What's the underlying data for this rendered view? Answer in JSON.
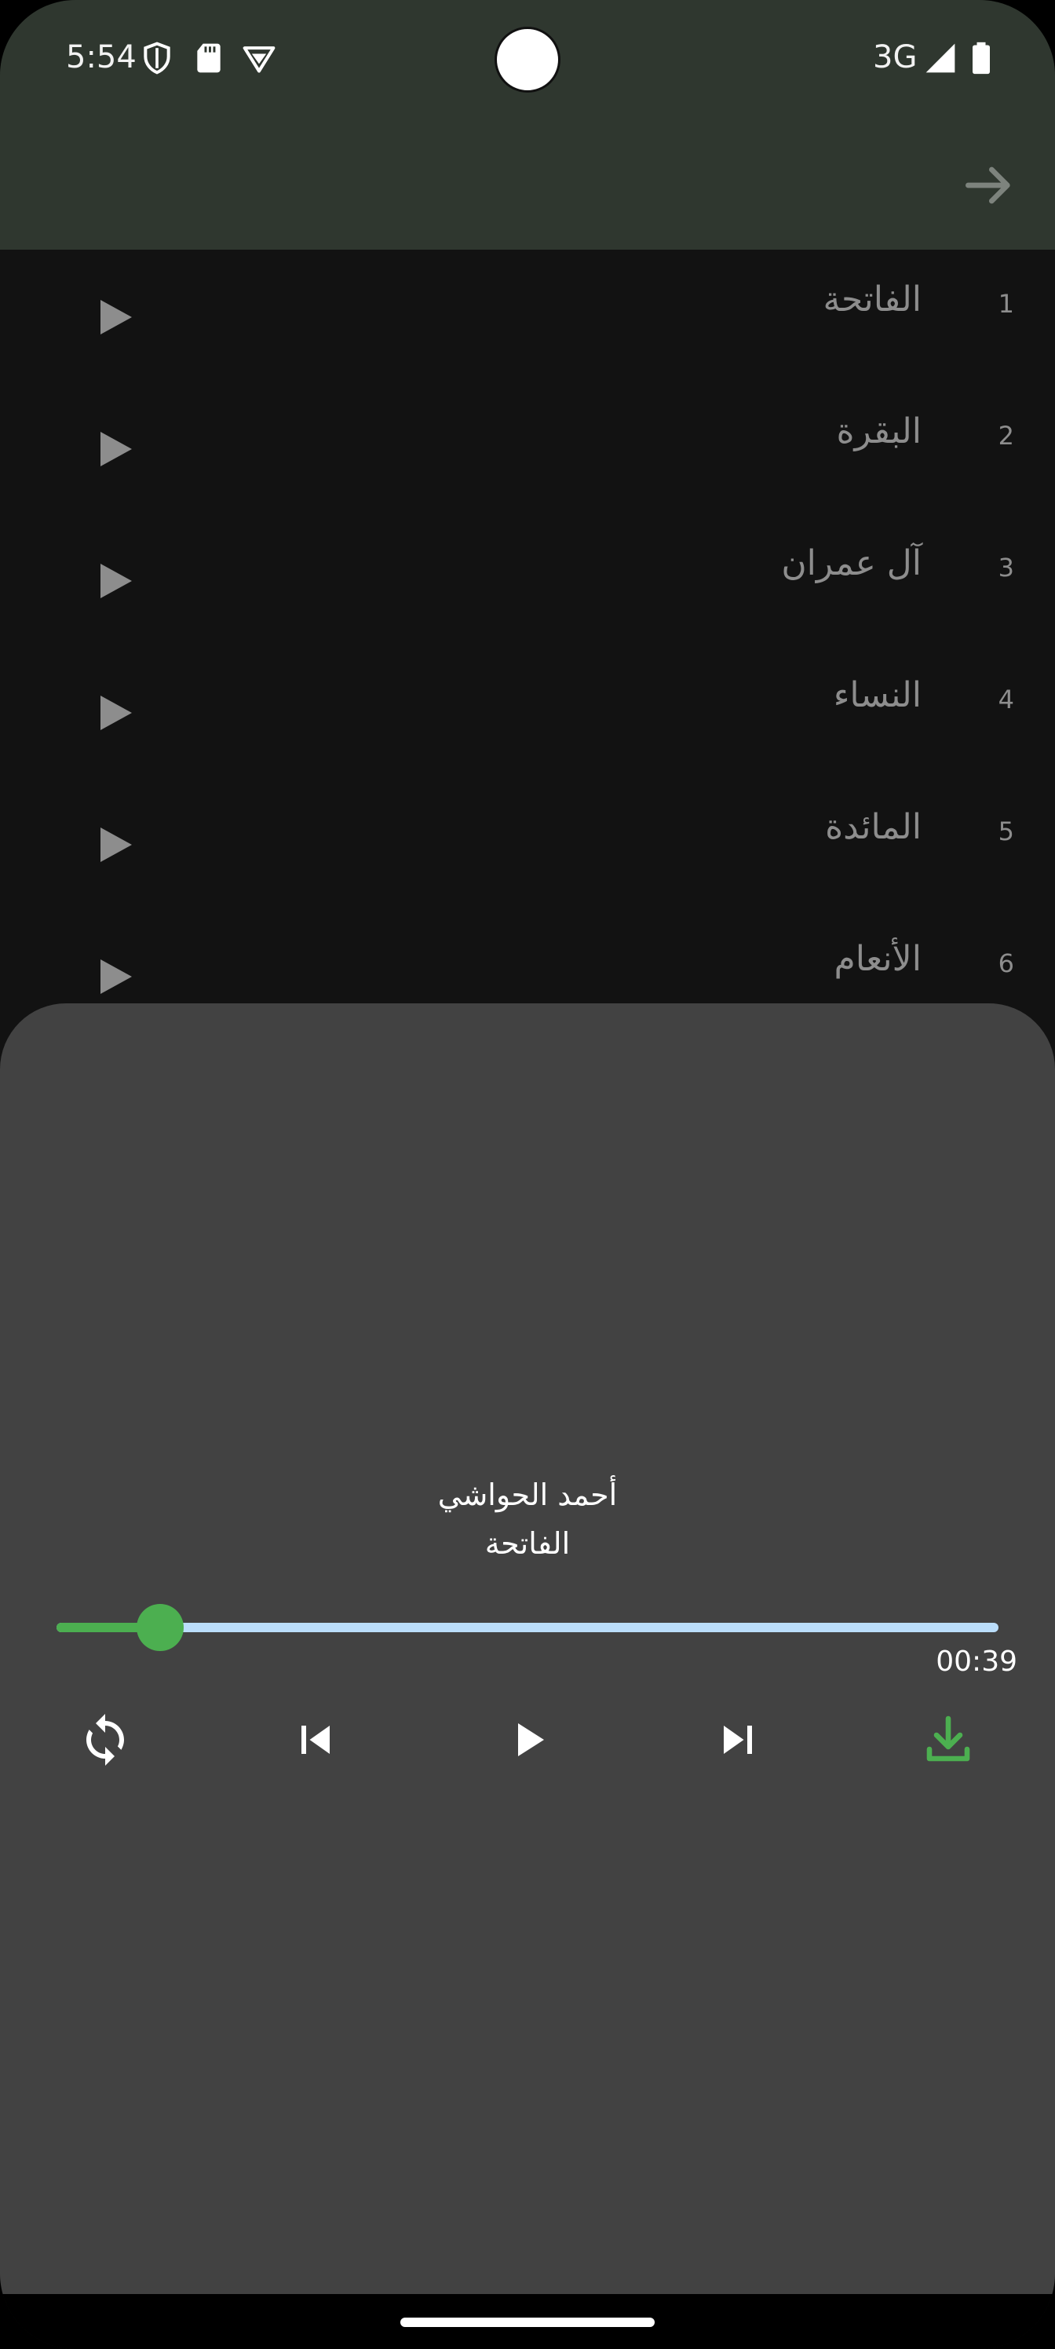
{
  "status_bar": {
    "time": "5:54",
    "network": "3G",
    "icons": [
      "shield-icon",
      "sd-card-icon",
      "vpn-icon",
      "signal-icon",
      "battery-icon"
    ]
  },
  "app_bar": {
    "back_icon": "arrow-right-icon"
  },
  "surah_list": [
    {
      "number": "1",
      "name": "الفاتحة"
    },
    {
      "number": "2",
      "name": "البقرة"
    },
    {
      "number": "3",
      "name": "آل عمران"
    },
    {
      "number": "4",
      "name": "النساء"
    },
    {
      "number": "5",
      "name": "المائدة"
    },
    {
      "number": "6",
      "name": "الأنعام"
    }
  ],
  "player": {
    "reciter": "أحمد الحواشي",
    "surah": "الفاتحة",
    "duration": "00:39",
    "progress": 0.11,
    "controls": [
      "repeat-icon",
      "skip-previous-icon",
      "play-icon",
      "skip-next-icon",
      "download-icon"
    ]
  },
  "colors": {
    "app_bar": "#2f372f",
    "background": "#121212",
    "sheet": "#424242",
    "accent": "#4caf50",
    "track": "#bbdefb",
    "muted_text": "#8d8d8d"
  }
}
